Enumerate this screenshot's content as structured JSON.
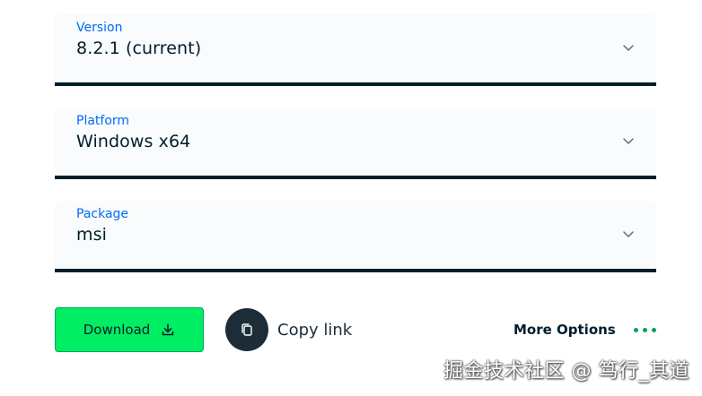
{
  "selects": {
    "version": {
      "label": "Version",
      "value": "8.2.1 (current)"
    },
    "platform": {
      "label": "Platform",
      "value": "Windows x64"
    },
    "package": {
      "label": "Package",
      "value": "msi"
    }
  },
  "actions": {
    "download_label": "Download",
    "copy_label": "Copy link",
    "more_label": "More Options"
  },
  "watermark": "掘金技术社区 @ 笃行_其道",
  "colors": {
    "accent_label": "#016bf8",
    "primary_button": "#00ed64",
    "dark": "#001e2b",
    "dots": "#00a35c"
  }
}
